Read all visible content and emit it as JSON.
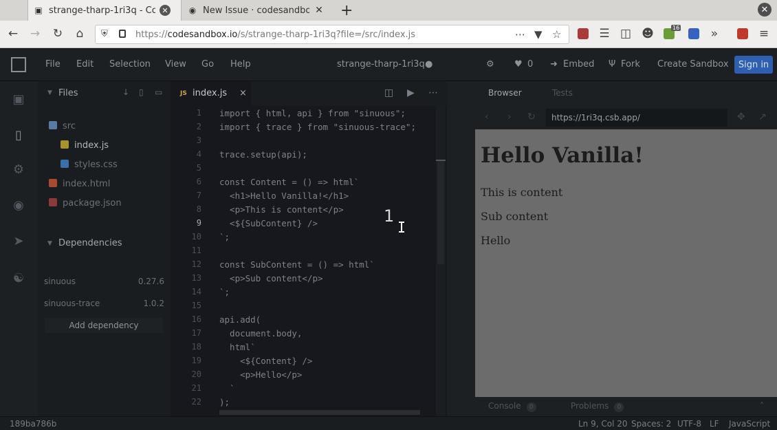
{
  "browser": {
    "tabs": [
      {
        "title": "strange-tharp-1ri3q - CodeSandbox",
        "active": true
      },
      {
        "title": "New Issue · codesandbox/codesandbox-client",
        "active": false
      }
    ],
    "url_prefix": "https://",
    "url_domain": "codesandbox.io",
    "url_path": "/s/strange-tharp-1ri3q?file=/src/index.js",
    "ext_badge": "16"
  },
  "app": {
    "menu": [
      "File",
      "Edit",
      "Selection",
      "View",
      "Go",
      "Help"
    ],
    "sandbox_title": "strange-tharp-1ri3q",
    "likes": "0",
    "embed": "Embed",
    "fork": "Fork",
    "create": "Create Sandbox",
    "signin": "Sign in"
  },
  "explorer": {
    "title": "Files",
    "files": [
      {
        "name": "src",
        "type": "folder"
      },
      {
        "name": "index.js",
        "type": "js"
      },
      {
        "name": "styles.css",
        "type": "css"
      },
      {
        "name": "index.html",
        "type": "html"
      },
      {
        "name": "package.json",
        "type": "json"
      }
    ],
    "dependencies_title": "Dependencies",
    "dependencies": [
      {
        "name": "sinuous",
        "version": "0.27.6"
      },
      {
        "name": "sinuous-trace",
        "version": "1.0.2"
      }
    ],
    "add_dependency": "Add dependency"
  },
  "editor": {
    "tab": "index.js",
    "tab_close": "×",
    "current_line": 9,
    "lines": [
      "import { html, api } from \"sinuous\";",
      "import { trace } from \"sinuous-trace\";",
      "",
      "trace.setup(api);",
      "",
      "const Content = () => html`",
      "  <h1>Hello Vanilla!</h1>",
      "  <p>This is content</p>",
      "  <${SubContent} />",
      "`;",
      "",
      "const SubContent = () => html`",
      "  <p>Sub content</p>",
      "`;",
      "",
      "api.add(",
      "  document.body,",
      "  html`",
      "    <${Content} />",
      "    <p>Hello</p>",
      "  `",
      ");"
    ],
    "overlay_number": "1"
  },
  "preview": {
    "tabs": [
      "Browser",
      "Tests"
    ],
    "url": "https://1ri3q.csb.app/",
    "heading": "Hello Vanilla!",
    "paragraphs": [
      "This is content",
      "Sub content",
      "Hello"
    ],
    "console": "Console",
    "console_count": "0",
    "problems": "Problems",
    "problems_count": "0"
  },
  "status": {
    "commit": "189ba786b",
    "position": "Ln 9, Col 20",
    "spaces": "Spaces: 2",
    "encoding": "UTF-8",
    "eol": "LF",
    "language": "JavaScript"
  }
}
